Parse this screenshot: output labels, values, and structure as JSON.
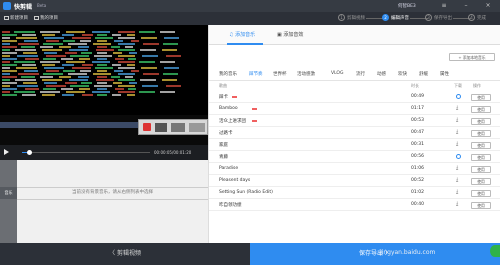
{
  "app": {
    "name": "快剪辑",
    "badge": "Beta",
    "user": "何智BE3"
  },
  "toolbar": {
    "new_project": "新建项目",
    "my_projects": "我的项目",
    "steps": [
      {
        "num": "1",
        "label": "剪辑视频"
      },
      {
        "num": "2",
        "label": "编辑声音"
      },
      {
        "num": "3",
        "label": "保存导出"
      },
      {
        "num": "4",
        "label": "完成"
      }
    ]
  },
  "player": {
    "time": "00:00:05/00:01:20",
    "progress": 0.06
  },
  "timeline": {
    "track_label": "音乐",
    "empty_text": "当前没有背景音乐，请从右侧列表中选择"
  },
  "music": {
    "tabs": [
      "添加音乐",
      "添加音效"
    ],
    "local_button": "+ 添加本地音乐",
    "categories": [
      "我的音乐",
      "踩节奏",
      "世界杯",
      "活动感激",
      "VLOG",
      "流行",
      "动感",
      "欢快",
      "舒缓",
      "属性"
    ],
    "active_category_index": 1,
    "headers": {
      "name": "歌曲",
      "duration": "时长",
      "download": "下载",
      "action": "操作"
    },
    "use_label": "使用",
    "rows": [
      {
        "name": "踩卡",
        "hot": true,
        "duration": "00:49",
        "downloaded": true
      },
      {
        "name": "Bamboo",
        "hot": true,
        "duration": "01:17",
        "downloaded": false
      },
      {
        "name": "活众上进求团",
        "hot": true,
        "duration": "00:53",
        "downloaded": false
      },
      {
        "name": "过路卡",
        "hot": false,
        "duration": "00:47",
        "downloaded": false
      },
      {
        "name": "家庭",
        "hot": false,
        "duration": "00:31",
        "downloaded": false
      },
      {
        "name": "青藤",
        "hot": false,
        "duration": "00:56",
        "downloaded": true
      },
      {
        "name": "Paradise",
        "hot": false,
        "duration": "01:06",
        "downloaded": false
      },
      {
        "name": "Pleasent days",
        "hot": false,
        "duration": "00:52",
        "downloaded": false
      },
      {
        "name": "Setting Sun (Radio Edit)",
        "hot": false,
        "duration": "01:02",
        "downloaded": false
      },
      {
        "name": "咋自领功绩",
        "hot": false,
        "duration": "00:40",
        "downloaded": false
      }
    ]
  },
  "bottom": {
    "back": "〈  剪辑视频",
    "save": "保存导出  〉",
    "watermark": "jingyan.baidu.com"
  }
}
